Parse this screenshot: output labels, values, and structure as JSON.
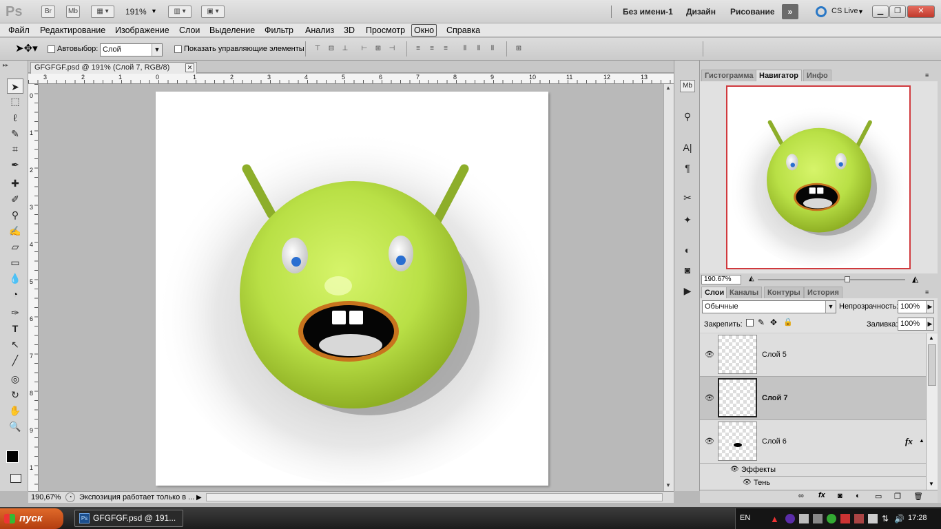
{
  "titlebar": {
    "logo": "Ps",
    "bridge": "Br",
    "minibridge": "Mb",
    "zoom": "191%",
    "doc_name": "Без имени-1",
    "workspace_1": "Дизайн",
    "workspace_2": "Рисование",
    "cslive": "CS Live"
  },
  "menu": [
    "Файл",
    "Редактирование",
    "Изображение",
    "Слои",
    "Выделение",
    "Фильтр",
    "Анализ",
    "3D",
    "Просмотр",
    "Окно",
    "Справка"
  ],
  "options": {
    "autoselect_label": "Автовыбор:",
    "autoselect_value": "Слой",
    "show_controls_label": "Показать управляющие элементы"
  },
  "document": {
    "tab_title": "GFGFGF.psd @ 191% (Слой 7, RGB/8)",
    "close": "✕",
    "ruler_top": [
      "3",
      "2",
      "1",
      "0",
      "1",
      "2",
      "3",
      "4",
      "5",
      "6",
      "7",
      "8",
      "9",
      "10",
      "11",
      "12",
      "13"
    ],
    "ruler_left": [
      "0",
      "1",
      "2",
      "3",
      "4",
      "5",
      "6",
      "7",
      "8",
      "9",
      "1"
    ]
  },
  "status": {
    "zoom": "190,67%",
    "info": "Экспозиция работает только в ..."
  },
  "navigator": {
    "tabs": [
      "Гистограмма",
      "Навигатор",
      "Инфо"
    ],
    "active_tab": "Навигатор",
    "zoom": "190.67%"
  },
  "layers_panel": {
    "tabs": [
      "Слои",
      "Каналы",
      "Контуры",
      "История"
    ],
    "active_tab": "Слои",
    "blend_mode": "Обычные",
    "opacity_label": "Непрозрачность:",
    "opacity": "100%",
    "lock_label": "Закрепить:",
    "fill_label": "Заливка:",
    "fill": "100%",
    "layers": [
      {
        "name": "Слой 5"
      },
      {
        "name": "Слой 7"
      },
      {
        "name": "Слой 6"
      }
    ],
    "fx_badge": "fx",
    "effects_label": "Эффекты",
    "effect_item": "Тень"
  },
  "taskbar": {
    "start": "пуск",
    "task": "GFGFGF.psd @ 191...",
    "lang": "EN",
    "clock": "17:28"
  },
  "colors": {
    "alien_green": "#b9e046",
    "navigator_frame": "#d0393d",
    "start_orange": "#d35a1e"
  }
}
